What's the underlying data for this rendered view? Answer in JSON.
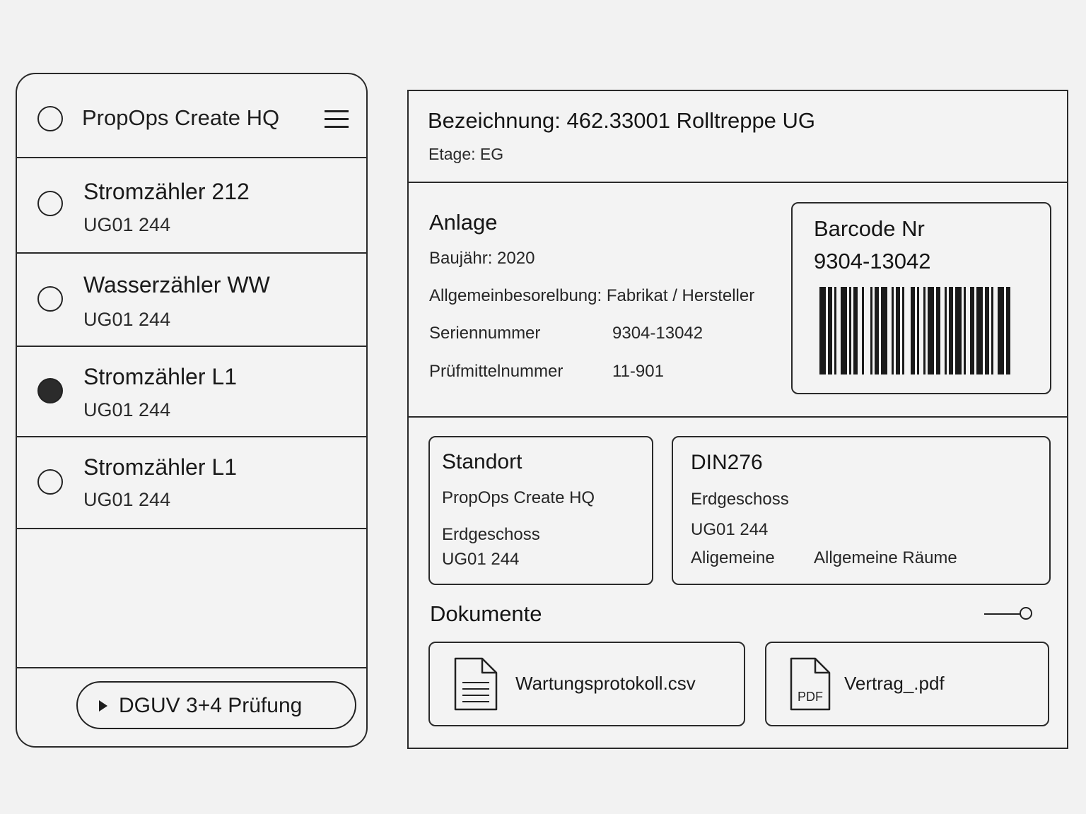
{
  "sidebar": {
    "title": "PropOps Create HQ",
    "items": [
      {
        "title": "Stromzähler 212",
        "subtitle": "UG01 244",
        "selected": false
      },
      {
        "title": "Wasserzähler WW",
        "subtitle": "UG01 244",
        "selected": false
      },
      {
        "title": "Stromzähler L1",
        "subtitle": "UG01 244",
        "selected": true
      },
      {
        "title": "Stromzähler L1",
        "subtitle": "UG01 244",
        "selected": false
      }
    ],
    "action_button": "DGUV 3+4 Prüfung"
  },
  "detail": {
    "title": "Bezeichnung: 462.33001 Rolltreppe UG",
    "etage": "Etage: EG",
    "anlage": {
      "heading": "Anlage",
      "baujahr": "Baujähr: 2020",
      "beschreibung": "Allgemeinbesorelbung: Fabrikat / Hersteller",
      "seriennummer_label": "Seriennummer",
      "seriennummer_value": "9304-13042",
      "pruefmittel_label": "Prüfmittelnummer",
      "pruefmittel_value": "11-901"
    },
    "barcode": {
      "label": "Barcode Nr",
      "number": "9304-13042"
    },
    "standort": {
      "heading": "Standort",
      "line1": "PropOps Create HQ",
      "line2": "Erdgeschoss",
      "line3": "UG01 244"
    },
    "din276": {
      "heading": "DIN276",
      "line1": "Erdgeschoss",
      "line2": "UG01 244",
      "line3_label": "Aligemeine",
      "line3_value": "Allgemeine Räume"
    },
    "dokumente": {
      "heading": "Dokumente",
      "files": [
        {
          "name": "Wartungsprotokoll.csv",
          "icon": "document-icon"
        },
        {
          "name": "Vertrag_.pdf",
          "icon": "pdf-icon",
          "badge": "PDF"
        }
      ]
    }
  },
  "colors": {
    "background": "#f2f2f2",
    "stroke": "#2a2a2a",
    "text": "#1c1c1c"
  }
}
